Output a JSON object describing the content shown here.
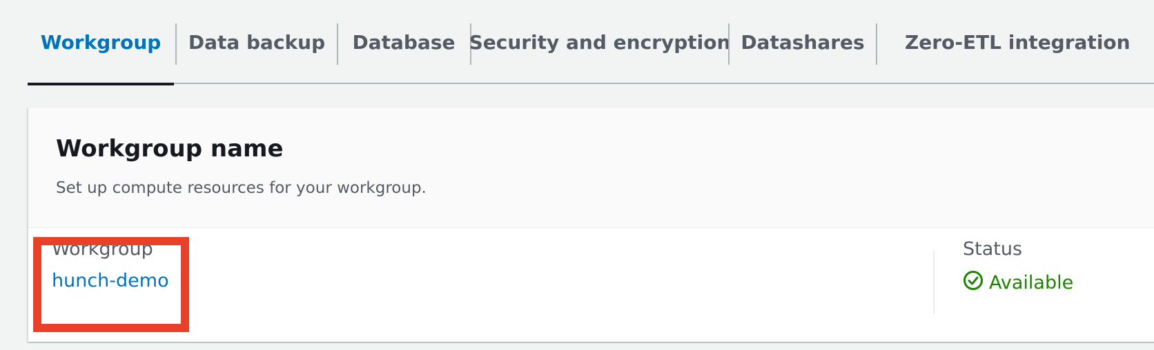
{
  "tabs": [
    {
      "label": "Workgroup",
      "active": true
    },
    {
      "label": "Data backup",
      "active": false
    },
    {
      "label": "Database",
      "active": false
    },
    {
      "label": "Security and encryption",
      "active": false
    },
    {
      "label": "Datashares",
      "active": false
    },
    {
      "label": "Zero-ETL integration",
      "active": false
    }
  ],
  "panel": {
    "title": "Workgroup name",
    "description": "Set up compute resources for your workgroup."
  },
  "workgroup": {
    "label": "Workgroup",
    "value": "hunch-demo"
  },
  "status": {
    "label": "Status",
    "value": "Available",
    "icon": "check-circle-icon",
    "color": "#1d8102"
  },
  "colors": {
    "accent": "#0073bb",
    "highlight": "#e8412a"
  }
}
